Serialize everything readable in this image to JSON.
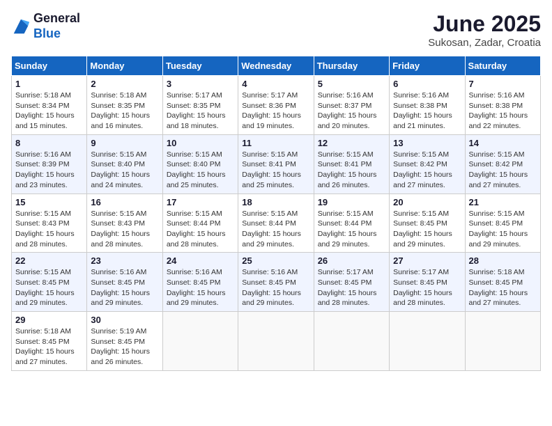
{
  "header": {
    "logo_general": "General",
    "logo_blue": "Blue",
    "month_title": "June 2025",
    "location": "Sukosan, Zadar, Croatia"
  },
  "weekdays": [
    "Sunday",
    "Monday",
    "Tuesday",
    "Wednesday",
    "Thursday",
    "Friday",
    "Saturday"
  ],
  "weeks": [
    [
      {
        "day": "1",
        "sunrise": "5:18 AM",
        "sunset": "8:34 PM",
        "daylight": "15 hours and 15 minutes."
      },
      {
        "day": "2",
        "sunrise": "5:18 AM",
        "sunset": "8:35 PM",
        "daylight": "15 hours and 16 minutes."
      },
      {
        "day": "3",
        "sunrise": "5:17 AM",
        "sunset": "8:35 PM",
        "daylight": "15 hours and 18 minutes."
      },
      {
        "day": "4",
        "sunrise": "5:17 AM",
        "sunset": "8:36 PM",
        "daylight": "15 hours and 19 minutes."
      },
      {
        "day": "5",
        "sunrise": "5:16 AM",
        "sunset": "8:37 PM",
        "daylight": "15 hours and 20 minutes."
      },
      {
        "day": "6",
        "sunrise": "5:16 AM",
        "sunset": "8:38 PM",
        "daylight": "15 hours and 21 minutes."
      },
      {
        "day": "7",
        "sunrise": "5:16 AM",
        "sunset": "8:38 PM",
        "daylight": "15 hours and 22 minutes."
      }
    ],
    [
      {
        "day": "8",
        "sunrise": "5:16 AM",
        "sunset": "8:39 PM",
        "daylight": "15 hours and 23 minutes."
      },
      {
        "day": "9",
        "sunrise": "5:15 AM",
        "sunset": "8:40 PM",
        "daylight": "15 hours and 24 minutes."
      },
      {
        "day": "10",
        "sunrise": "5:15 AM",
        "sunset": "8:40 PM",
        "daylight": "15 hours and 25 minutes."
      },
      {
        "day": "11",
        "sunrise": "5:15 AM",
        "sunset": "8:41 PM",
        "daylight": "15 hours and 25 minutes."
      },
      {
        "day": "12",
        "sunrise": "5:15 AM",
        "sunset": "8:41 PM",
        "daylight": "15 hours and 26 minutes."
      },
      {
        "day": "13",
        "sunrise": "5:15 AM",
        "sunset": "8:42 PM",
        "daylight": "15 hours and 27 minutes."
      },
      {
        "day": "14",
        "sunrise": "5:15 AM",
        "sunset": "8:42 PM",
        "daylight": "15 hours and 27 minutes."
      }
    ],
    [
      {
        "day": "15",
        "sunrise": "5:15 AM",
        "sunset": "8:43 PM",
        "daylight": "15 hours and 28 minutes."
      },
      {
        "day": "16",
        "sunrise": "5:15 AM",
        "sunset": "8:43 PM",
        "daylight": "15 hours and 28 minutes."
      },
      {
        "day": "17",
        "sunrise": "5:15 AM",
        "sunset": "8:44 PM",
        "daylight": "15 hours and 28 minutes."
      },
      {
        "day": "18",
        "sunrise": "5:15 AM",
        "sunset": "8:44 PM",
        "daylight": "15 hours and 29 minutes."
      },
      {
        "day": "19",
        "sunrise": "5:15 AM",
        "sunset": "8:44 PM",
        "daylight": "15 hours and 29 minutes."
      },
      {
        "day": "20",
        "sunrise": "5:15 AM",
        "sunset": "8:45 PM",
        "daylight": "15 hours and 29 minutes."
      },
      {
        "day": "21",
        "sunrise": "5:15 AM",
        "sunset": "8:45 PM",
        "daylight": "15 hours and 29 minutes."
      }
    ],
    [
      {
        "day": "22",
        "sunrise": "5:15 AM",
        "sunset": "8:45 PM",
        "daylight": "15 hours and 29 minutes."
      },
      {
        "day": "23",
        "sunrise": "5:16 AM",
        "sunset": "8:45 PM",
        "daylight": "15 hours and 29 minutes."
      },
      {
        "day": "24",
        "sunrise": "5:16 AM",
        "sunset": "8:45 PM",
        "daylight": "15 hours and 29 minutes."
      },
      {
        "day": "25",
        "sunrise": "5:16 AM",
        "sunset": "8:45 PM",
        "daylight": "15 hours and 29 minutes."
      },
      {
        "day": "26",
        "sunrise": "5:17 AM",
        "sunset": "8:45 PM",
        "daylight": "15 hours and 28 minutes."
      },
      {
        "day": "27",
        "sunrise": "5:17 AM",
        "sunset": "8:45 PM",
        "daylight": "15 hours and 28 minutes."
      },
      {
        "day": "28",
        "sunrise": "5:18 AM",
        "sunset": "8:45 PM",
        "daylight": "15 hours and 27 minutes."
      }
    ],
    [
      {
        "day": "29",
        "sunrise": "5:18 AM",
        "sunset": "8:45 PM",
        "daylight": "15 hours and 27 minutes."
      },
      {
        "day": "30",
        "sunrise": "5:19 AM",
        "sunset": "8:45 PM",
        "daylight": "15 hours and 26 minutes."
      },
      null,
      null,
      null,
      null,
      null
    ]
  ]
}
